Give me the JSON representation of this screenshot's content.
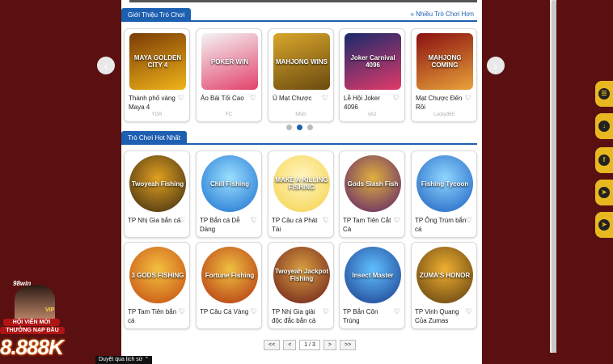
{
  "intro_section": {
    "title": "Giới Thiệu Trò Chơi",
    "more_link": "» Nhiều Trò Chơi Hơn",
    "games": [
      {
        "name": "Thành phố vàng Maya 4",
        "vendor": "YGR",
        "art_text": "MAYA GOLDEN CITY 4",
        "color1": "#7a3b06",
        "color2": "#f0b419"
      },
      {
        "name": "Áo Bài Tối Cao",
        "vendor": "FC",
        "art_text": "POKER WIN",
        "color1": "#f4f4f4",
        "color2": "#e2426b"
      },
      {
        "name": "Ù Mạt Chược",
        "vendor": "NNG",
        "art_text": "MAHJONG WINS",
        "color1": "#d9a62b",
        "color2": "#6a4a10"
      },
      {
        "name": "Lễ Hội Joker 4096",
        "vendor": "VA2",
        "art_text": "Joker Carnival 4096",
        "color1": "#1a2a6b",
        "color2": "#e23a6a"
      },
      {
        "name": "Mạt Chược Đến Rồi",
        "vendor": "Lucky365",
        "art_text": "MAHJONG COMING",
        "color1": "#8a1010",
        "color2": "#e8a23a"
      }
    ],
    "dots": [
      "",
      "active",
      ""
    ]
  },
  "hot_section": {
    "title": "Trò Chơi Hot Nhất",
    "games_row1": [
      {
        "name": "TP Nhị Gia bắn cá",
        "art_text": "Twoyeah Fishing",
        "color1": "#3a2a12",
        "color2": "#e0a020"
      },
      {
        "name": "TP Bắn cá Dễ Dàng",
        "art_text": "Chill Fishing",
        "color1": "#1a6fd0",
        "color2": "#9be0ff"
      },
      {
        "name": "TP Câu cá Phát Tài",
        "art_text": "MAKE A KILLING FISHING",
        "color1": "#f5d14a",
        "color2": "#fff6c0"
      },
      {
        "name": "TP Tam Tiên Cắt Cá",
        "art_text": "Gods Slash Fish",
        "color1": "#5a1f6b",
        "color2": "#e0b040"
      },
      {
        "name": "TP Ông Trùm bắn cá",
        "art_text": "Fishing Tycoon",
        "color1": "#1a5fc0",
        "color2": "#90d6ff"
      }
    ],
    "games_row2": [
      {
        "name": "TP Tam Tiên bắn cá",
        "art_text": "3 GODS FISHING",
        "color1": "#c24a10",
        "color2": "#f5c040"
      },
      {
        "name": "TP Câu Cá Vàng",
        "art_text": "Fortune Fishing",
        "color1": "#b03010",
        "color2": "#f0c040"
      },
      {
        "name": "TP Nhị Gia giải độc đắc bắn cá",
        "art_text": "Twoyeah Jackpot Fishing",
        "color1": "#6a1a1a",
        "color2": "#d8a040"
      },
      {
        "name": "TP Bắn Côn Trùng",
        "art_text": "Insect Master",
        "color1": "#1a3a8a",
        "color2": "#60c0ff"
      },
      {
        "name": "TP Vinh Quang Của Zumas",
        "art_text": "ZUMA'S HONOR",
        "color1": "#5a3a10",
        "color2": "#f0b030"
      }
    ]
  },
  "pagination": {
    "first": "<<",
    "prev": "<",
    "info": "1 / 3",
    "next": ">",
    "last": ">>"
  },
  "side_buttons": [
    "chat-icon",
    "download-icon",
    "facebook-icon",
    "telegram-icon",
    "telegram-alt-icon"
  ],
  "promo": {
    "brand": "98win",
    "vip": "VIP",
    "line1": "HỘI VIÊN MỚI",
    "line2": "THƯỞNG NẠP ĐẦU",
    "amount": "8.888K"
  },
  "tooltip": "Duyệt qua lịch sử ⌃"
}
